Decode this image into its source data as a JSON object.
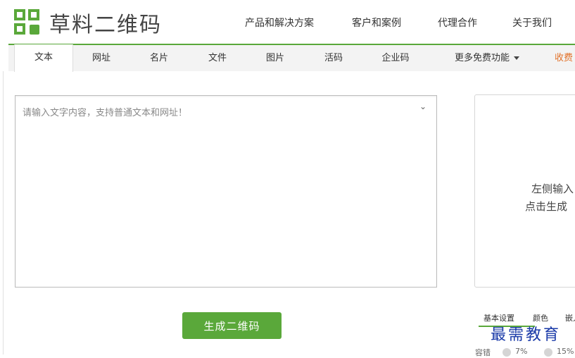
{
  "brand": {
    "name": "草料二维码",
    "accent": "#5aa83a"
  },
  "top_nav": [
    "产品和解决方案",
    "客户和案例",
    "代理合作",
    "关于我们"
  ],
  "tabs": [
    {
      "label": "文本",
      "active": true
    },
    {
      "label": "网址"
    },
    {
      "label": "名片"
    },
    {
      "label": "文件"
    },
    {
      "label": "图片"
    },
    {
      "label": "活码"
    },
    {
      "label": "企业码"
    },
    {
      "label": "更多免费功能",
      "dropdown": true
    },
    {
      "label": "收费"
    }
  ],
  "editor": {
    "placeholder": "请输入文字内容，支持普通文本和网址！",
    "toggle_icon": "chevron-down-icon"
  },
  "generate_button": "生成二维码",
  "preview": {
    "line1": "左侧输入",
    "line2": "点击生成"
  },
  "settings_tabs": [
    "基本设置",
    "颜色",
    "嵌入"
  ],
  "tolerance": {
    "label": "容错",
    "options": [
      "7%",
      "15%"
    ]
  },
  "watermark": "最需教育",
  "colors": {
    "green": "#5aa83a",
    "orange": "#e2722b",
    "watermark": "#1a3aa8"
  }
}
